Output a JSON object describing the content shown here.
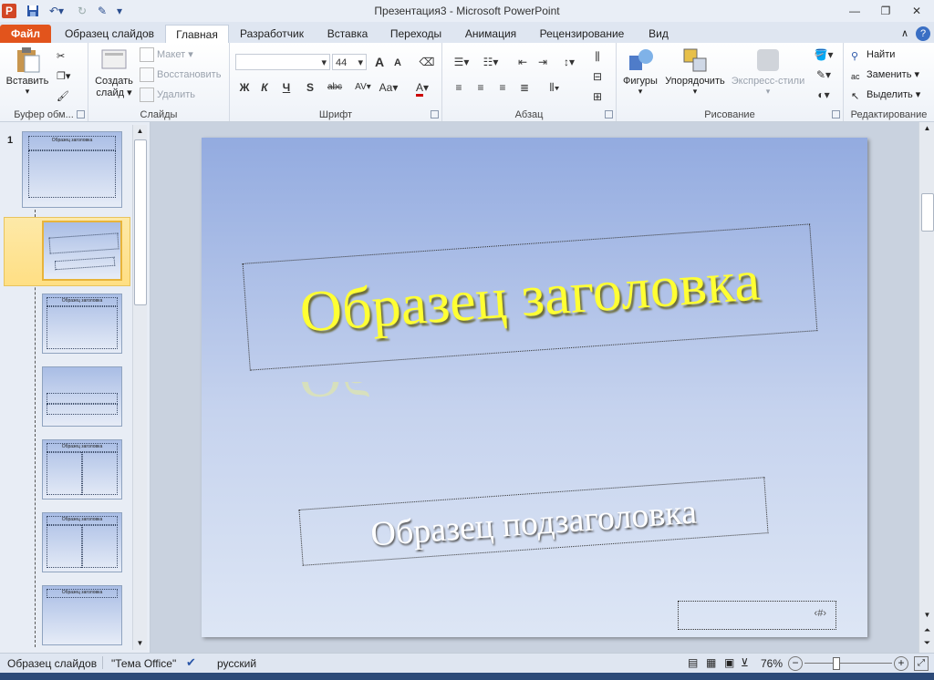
{
  "window": {
    "title": "Презентация3  -  Microsoft PowerPoint"
  },
  "qat": [
    "save-icon",
    "undo-icon",
    "redo-icon",
    "repeat-icon"
  ],
  "tabs": [
    {
      "label": "Файл"
    },
    {
      "label": "Образец слайдов"
    },
    {
      "label": "Главная"
    },
    {
      "label": "Разработчик"
    },
    {
      "label": "Вставка"
    },
    {
      "label": "Переходы"
    },
    {
      "label": "Анимация"
    },
    {
      "label": "Рецензирование"
    },
    {
      "label": "Вид"
    }
  ],
  "ribbon": {
    "clipboard": {
      "label": "Буфер обм...",
      "paste": "Вставить"
    },
    "slides": {
      "label": "Слайды",
      "new_slide_line1": "Создать",
      "new_slide_line2": "слайд",
      "layout": "Макет",
      "reset": "Восстановить",
      "delete": "Удалить"
    },
    "font": {
      "label": "Шрифт",
      "font_name": "",
      "font_size": "44",
      "bold": "Ж",
      "italic": "К",
      "underline": "Ч",
      "shadow": "S",
      "strike": "abc",
      "spacing": "AV",
      "case": "Aa",
      "color": "A",
      "grow": "A",
      "shrink": "A"
    },
    "paragraph": {
      "label": "Абзац"
    },
    "drawing": {
      "label": "Рисование",
      "shapes": "Фигуры",
      "arrange": "Упорядочить",
      "quick_styles": "Экспресс-стили"
    },
    "editing": {
      "label": "Редактирование",
      "find": "Найти",
      "replace": "Заменить",
      "select": "Выделить"
    }
  },
  "pane": {
    "first_number": "1"
  },
  "slide": {
    "title": "Образец заголовка",
    "subtitle": "Образец подзаголовка",
    "number_field": "‹#›"
  },
  "status": {
    "view": "Образец слайдов",
    "theme": "\"Тема Office\"",
    "language": "русский",
    "zoom": "76%"
  },
  "colors": {
    "title_text": "#ffff33",
    "file_tab": "#e2541c",
    "slide_top": "#93abe0",
    "slide_bottom": "#dde6f5"
  }
}
